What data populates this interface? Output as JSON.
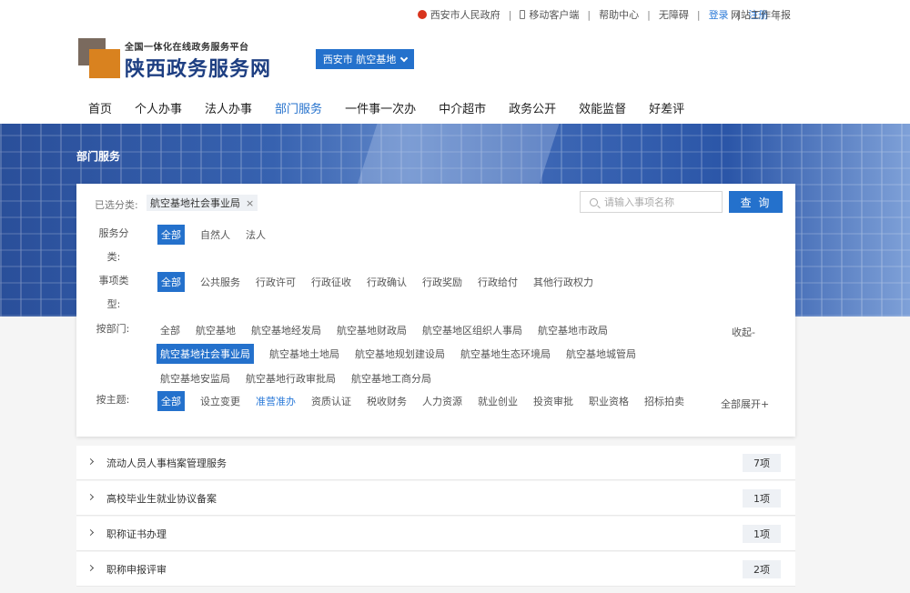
{
  "topbar": {
    "gov_link": "西安市人民政府",
    "mobile_link": "移动客户端",
    "help_link": "帮助中心",
    "access_link": "无障碍",
    "login_link": "登录",
    "register_link": "注册",
    "annual_report_link": "网站工作年报"
  },
  "header": {
    "logo_subtitle": "全国一体化在线政务服务平台",
    "logo_title": "陕西政务服务网",
    "city_selector": "西安市 航空基地"
  },
  "nav": {
    "items": [
      "首页",
      "个人办事",
      "法人办事",
      "部门服务",
      "一件事一次办",
      "中介超市",
      "政务公开",
      "效能监督",
      "好差评"
    ],
    "active": "部门服务"
  },
  "banner": {
    "title": "部门服务"
  },
  "filter": {
    "selected_label": "已选分类:",
    "selected_chip": "航空基地社会事业局",
    "chip_close": "×",
    "search_placeholder": "请输入事项名称",
    "search_button": "查 询",
    "service_label_1": "服务分",
    "service_label_2": "类:",
    "service_options": [
      "全部",
      "自然人",
      "法人"
    ],
    "matter_label_1": "事项类",
    "matter_label_2": "型:",
    "matter_options": [
      "全部",
      "公共服务",
      "行政许可",
      "行政征收",
      "行政确认",
      "行政奖励",
      "行政给付",
      "其他行政权力"
    ],
    "dept_label": "按部门:",
    "dept_row1": [
      "全部",
      "航空基地",
      "航空基地经发局",
      "航空基地财政局",
      "航空基地区组织人事局",
      "航空基地市政局"
    ],
    "dept_row2": [
      "航空基地社会事业局",
      "航空基地土地局",
      "航空基地规划建设局",
      "航空基地生态环境局",
      "航空基地城管局"
    ],
    "dept_row3": [
      "航空基地安监局",
      "航空基地行政审批局",
      "航空基地工商分局"
    ],
    "collapse_link": "收起-",
    "theme_label": "按主题:",
    "theme_options": [
      "全部",
      "设立变更",
      "准营准办",
      "资质认证",
      "税收财务",
      "人力资源",
      "就业创业",
      "投资审批",
      "职业资格",
      "招标拍卖"
    ],
    "expand_all_link": "全部展开+"
  },
  "results": [
    {
      "name": "流动人员人事档案管理服务",
      "count": "7项"
    },
    {
      "name": "高校毕业生就业协议备案",
      "count": "1项"
    },
    {
      "name": "职称证书办理",
      "count": "1项"
    },
    {
      "name": "职称申报评审",
      "count": "2项"
    }
  ]
}
